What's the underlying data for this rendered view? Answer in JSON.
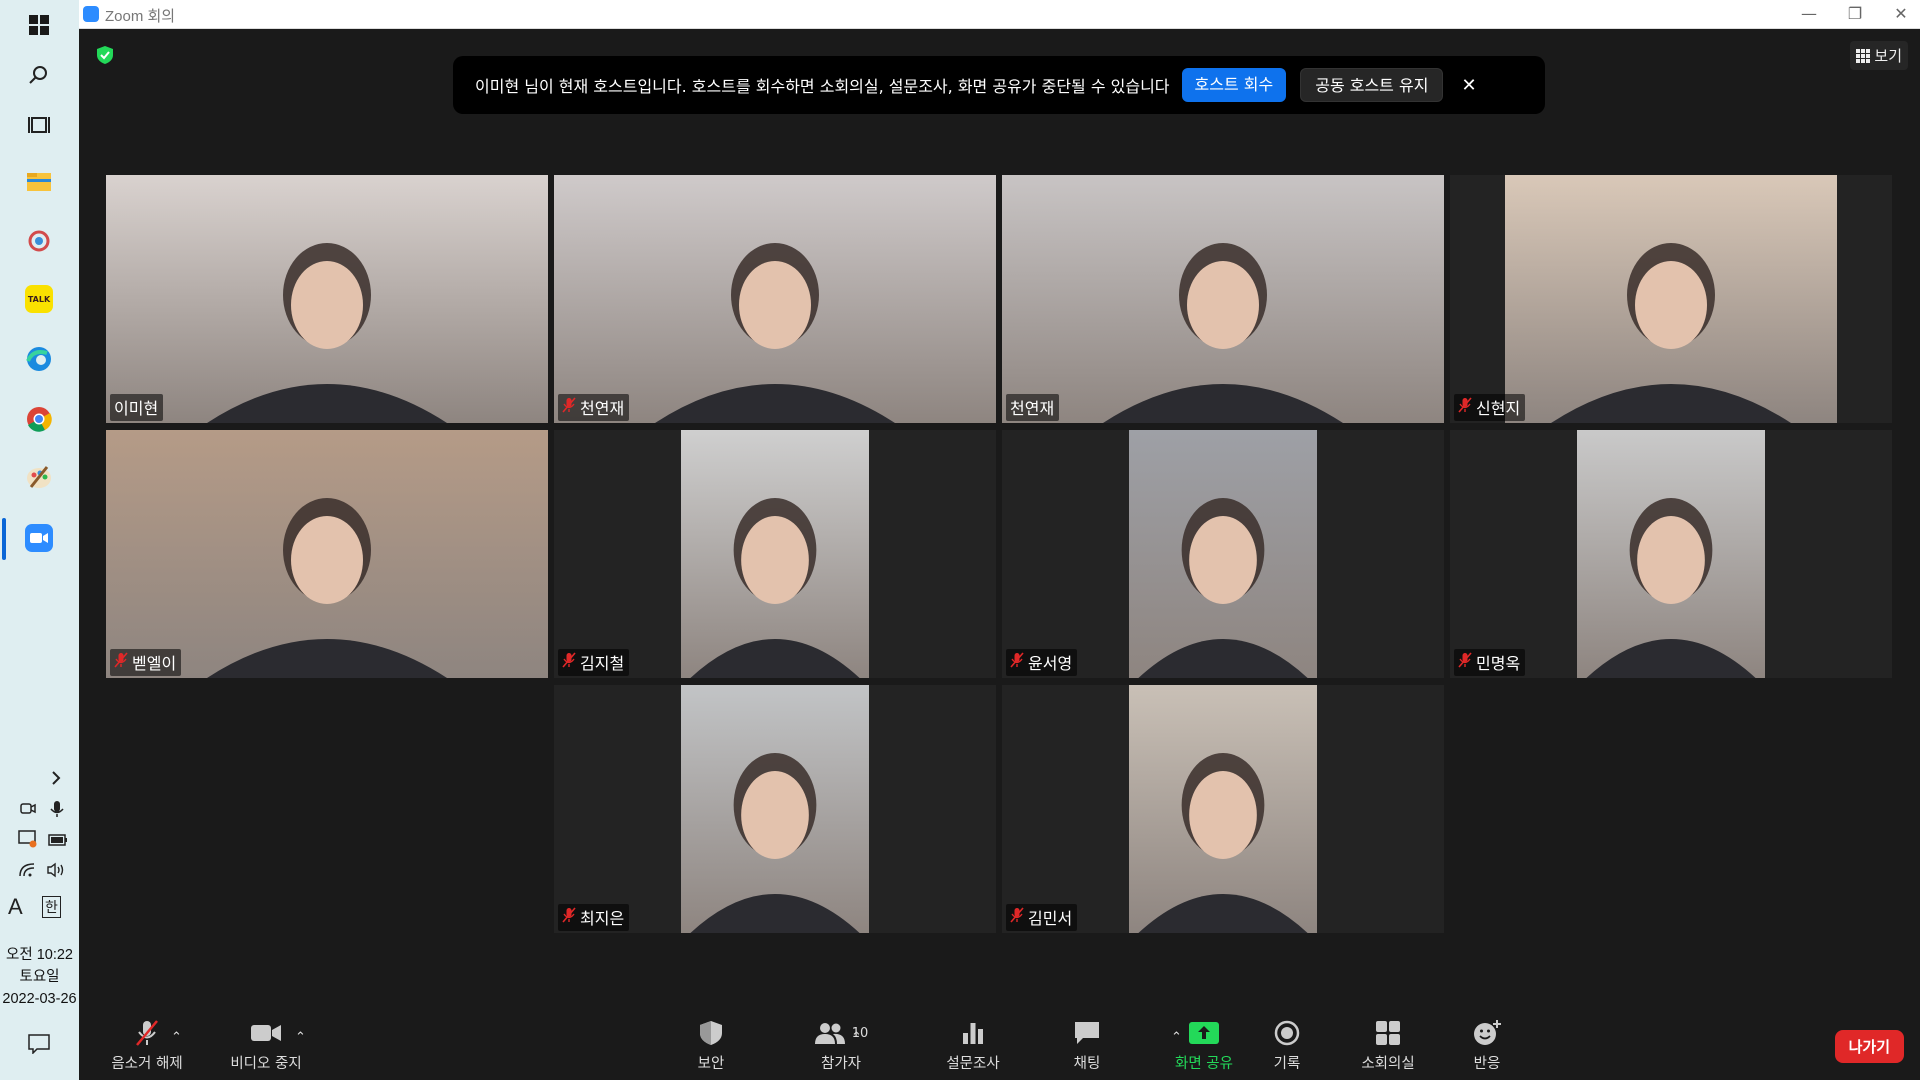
{
  "window": {
    "title": "Zoom 회의"
  },
  "taskbar": {
    "clock": {
      "period_time": "오전 10:22",
      "weekday": "토요일",
      "date": "2022-03-26"
    },
    "ime": {
      "letter": "A",
      "lang": "한"
    }
  },
  "top": {
    "view_label": "보기"
  },
  "banner": {
    "message": "이미현 님이 현재 호스트입니다. 호스트를 회수하면 소회의실, 설문조사, 화면 공유가 중단될 수 있습니다",
    "reclaim_label": "호스트 회수",
    "keep_label": "공동 호스트 유지",
    "close_glyph": "✕"
  },
  "participants": [
    {
      "name": "이미현",
      "muted": false,
      "active": true,
      "scene": "#d9d2cf"
    },
    {
      "name": "천연재",
      "muted": true,
      "active": false,
      "scene": "#cfcaca"
    },
    {
      "name": "천연재",
      "muted": false,
      "active": false,
      "scene": "#c8c4c4"
    },
    {
      "name": "신현지",
      "muted": true,
      "active": false,
      "scene": "#d9c8b8"
    },
    {
      "name": "벧엘이",
      "muted": true,
      "active": false,
      "scene": "#b59b87"
    },
    {
      "name": "김지철",
      "muted": true,
      "active": false,
      "scene": "#cfcfcf"
    },
    {
      "name": "윤서영",
      "muted": true,
      "active": false,
      "scene": "#9ea0a6"
    },
    {
      "name": "민명옥",
      "muted": true,
      "active": false,
      "scene": "#c9c9c9"
    },
    {
      "name": "최지은",
      "muted": true,
      "active": false,
      "scene": "#c2c4c6"
    },
    {
      "name": "김민서",
      "muted": true,
      "active": false,
      "scene": "#c9c0b6"
    }
  ],
  "toolbar": {
    "unmute": "음소거 해제",
    "stop_video": "비디오 중지",
    "security": "보안",
    "participants": "참가자",
    "participant_count": "10",
    "polls": "설문조사",
    "chat": "채팅",
    "share": "화면 공유",
    "record": "기록",
    "breakout": "소회의실",
    "reactions": "반응",
    "leave": "나가기"
  },
  "colors": {
    "accent": "#0e72ed",
    "share": "#23d959",
    "leave": "#e02828",
    "active_speaker": "#e7f24b"
  }
}
